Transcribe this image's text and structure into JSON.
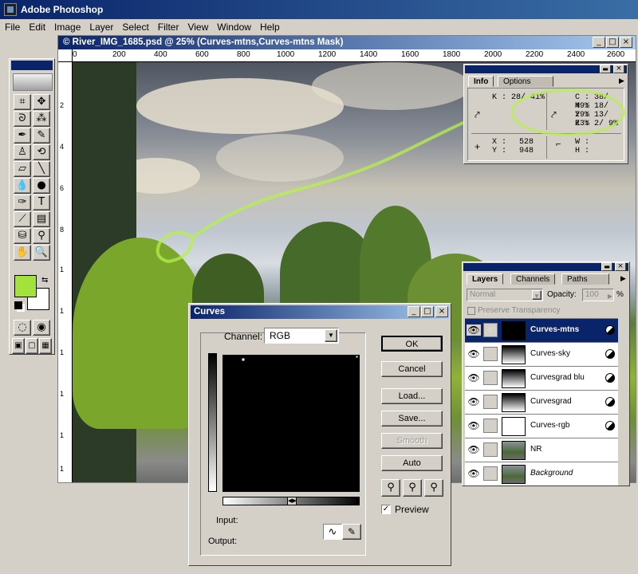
{
  "app": {
    "title": "Adobe Photoshop"
  },
  "menu": [
    "File",
    "Edit",
    "Image",
    "Layer",
    "Select",
    "Filter",
    "View",
    "Window",
    "Help"
  ],
  "document": {
    "title": "© River_IMG_1685.psd @ 25% (Curves-mtns,Curves-mtns Mask)",
    "ruler_top": [
      "0",
      "200",
      "400",
      "600",
      "800",
      "1000",
      "1200",
      "1400",
      "1600",
      "1800",
      "2000",
      "2200",
      "2400",
      "2600"
    ],
    "ruler_left": [
      "2",
      "4",
      "6",
      "8",
      "1",
      "1",
      "1",
      "1",
      "1",
      "1",
      "2"
    ]
  },
  "info": {
    "tabs": [
      "Info",
      "Options"
    ],
    "k_readout": "K :  28/ 41%",
    "c": "C :  38/ 49%",
    "m": "M :  18/ 29%",
    "y": "Y :  13/ 23%",
    "k": "K :    2/  9%",
    "x_label": "X :",
    "x_value": "528",
    "y_label": "Y :",
    "y_value": "948",
    "w_label": "W :",
    "h_label": "H :"
  },
  "layers": {
    "tabs": [
      "Layers",
      "Channels",
      "Paths"
    ],
    "blend_mode": "Normal",
    "opacity_label": "Opacity:",
    "opacity_value": "100",
    "opacity_unit": "%",
    "preserve_label": "Preserve Transparency",
    "items": [
      {
        "name": "Curves-mtns"
      },
      {
        "name": "Curves-sky"
      },
      {
        "name": "Curvesgrad blu"
      },
      {
        "name": "Curvesgrad"
      },
      {
        "name": "Curves-rgb"
      },
      {
        "name": "NR"
      },
      {
        "name": "Background"
      }
    ]
  },
  "curves": {
    "title": "Curves",
    "channel_label": "Channel:",
    "channel_value": "RGB",
    "buttons": {
      "ok": "OK",
      "cancel": "Cancel",
      "load": "Load...",
      "save": "Save...",
      "smooth": "Smooth",
      "auto": "Auto"
    },
    "preview_label": "Preview",
    "input_label": "Input:",
    "output_label": "Output:"
  },
  "colors": {
    "foreground": "#a3e23b",
    "background": "#ffffff",
    "title_bar": "#0a246a"
  }
}
